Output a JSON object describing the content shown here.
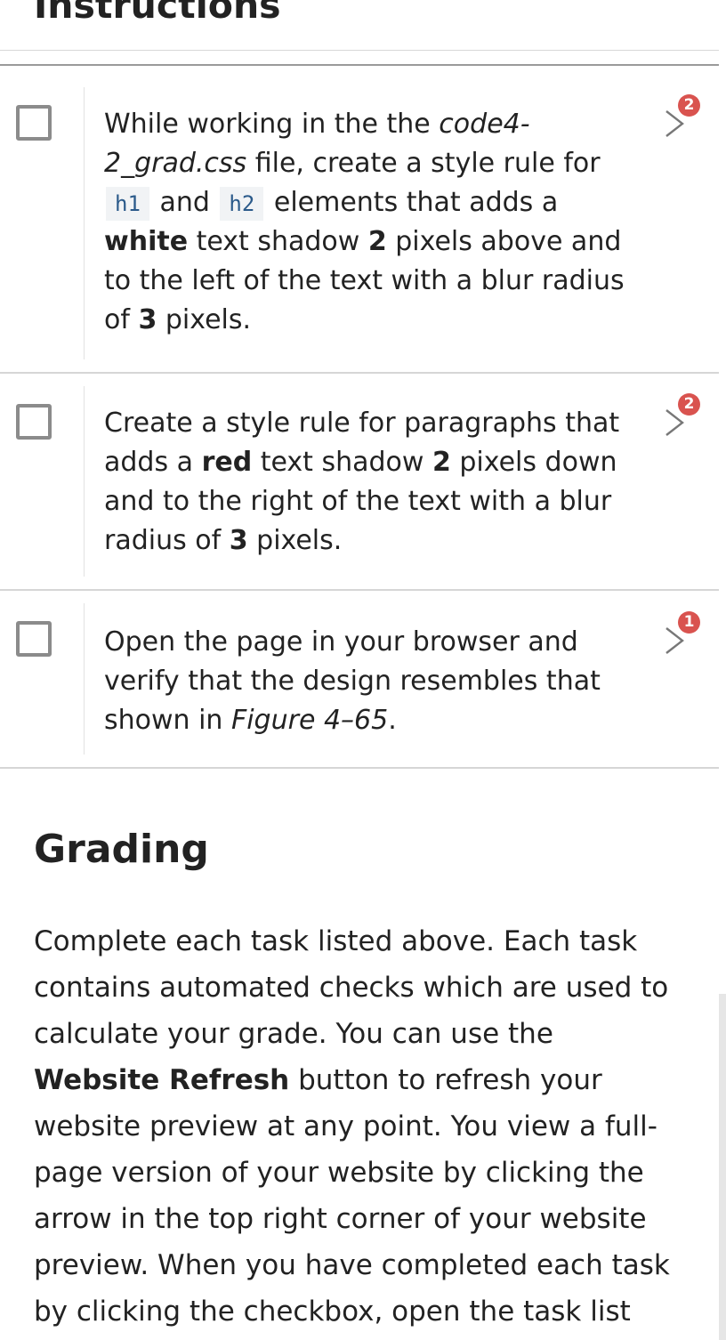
{
  "header": {
    "title": "Instructions"
  },
  "tasks": [
    {
      "badge": "2",
      "segments": [
        {
          "t": "While working in the the "
        },
        {
          "t": "code4-2_grad.css",
          "s": "i"
        },
        {
          "t": " file, create a style rule for "
        },
        {
          "t": "h1",
          "s": "code"
        },
        {
          "t": " and "
        },
        {
          "t": "h2",
          "s": "code"
        },
        {
          "t": " elements that adds a "
        },
        {
          "t": "white",
          "s": "b"
        },
        {
          "t": " text shadow "
        },
        {
          "t": "2",
          "s": "b"
        },
        {
          "t": " pixels above and to the left of the text with a blur radius of "
        },
        {
          "t": "3",
          "s": "b"
        },
        {
          "t": " pixels."
        }
      ]
    },
    {
      "badge": "2",
      "segments": [
        {
          "t": "Create a style rule for paragraphs that adds a "
        },
        {
          "t": "red",
          "s": "b"
        },
        {
          "t": " text shadow "
        },
        {
          "t": "2",
          "s": "b"
        },
        {
          "t": " pixels down and to the right of the text with a blur radius of "
        },
        {
          "t": "3",
          "s": "b"
        },
        {
          "t": " pixels."
        }
      ]
    },
    {
      "badge": "1",
      "segments": [
        {
          "t": "Open the page in your browser and verify that the design resembles that shown in "
        },
        {
          "t": "Figure 4–65",
          "s": "i"
        },
        {
          "t": "."
        }
      ]
    }
  ],
  "grading": {
    "title": "Grading",
    "segments": [
      {
        "t": "Complete each task listed above. Each task contains automated checks which are used to calculate your grade. You can use the "
      },
      {
        "t": "Website Refresh",
        "s": "b"
      },
      {
        "t": " button to refresh your website preview at any point. You view a full-page version of your website by clicking the arrow in the top right corner of your website preview. When you have completed each task by clicking the checkbox, open the task list panel on the left"
      }
    ]
  },
  "colors": {
    "badge": "#d9534f",
    "code_bg": "#f1f3f5",
    "code_text": "#2b5a8a"
  },
  "icons": {
    "checkbox": "checkbox-icon",
    "expand": "chevron-right-icon"
  }
}
